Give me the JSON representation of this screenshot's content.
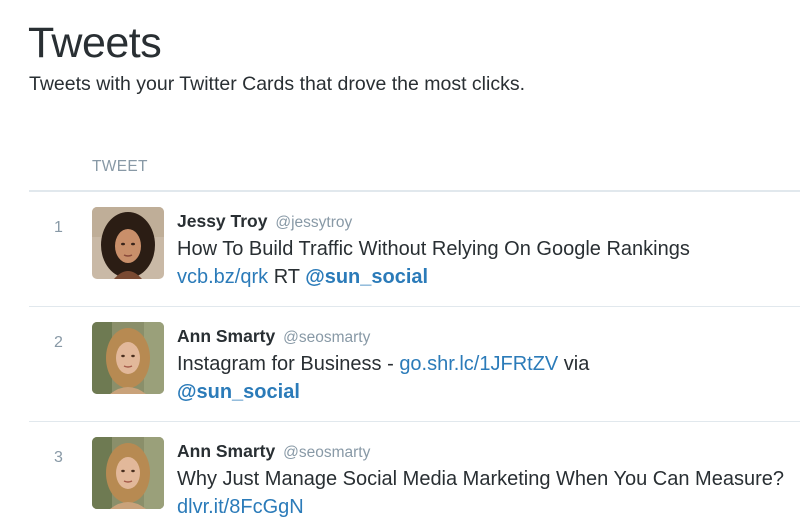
{
  "header": {
    "title": "Tweets",
    "subtitle": "Tweets with your Twitter Cards that drove the most clicks."
  },
  "table": {
    "column_header": "TWEET"
  },
  "tweets": [
    {
      "rank": "1",
      "name": "Jessy Troy",
      "handle": "@jessytroy",
      "avatar": "avatar-dark-curly-hair",
      "text_before": "How To Build Traffic Without Relying On Google Rankings",
      "link": "vcb.bz/qrk",
      "text_middle": " RT ",
      "mention": "@sun_social"
    },
    {
      "rank": "2",
      "name": "Ann Smarty",
      "handle": "@seosmarty",
      "avatar": "avatar-blonde-hair",
      "text_before": "Instagram for Business - ",
      "link": "go.shr.lc/1JFRtZV",
      "text_middle": " via",
      "mention": "@sun_social"
    },
    {
      "rank": "3",
      "name": "Ann Smarty",
      "handle": "@seosmarty",
      "avatar": "avatar-blonde-hair",
      "text_before": "Why Just Manage Social Media Marketing When You Can Measure? ",
      "link": "dlvr.it/8FcGgN"
    }
  ],
  "colors": {
    "text": "#292f33",
    "muted": "#8899a6",
    "link": "#2b7bb9",
    "divider": "#e1e8ed"
  }
}
